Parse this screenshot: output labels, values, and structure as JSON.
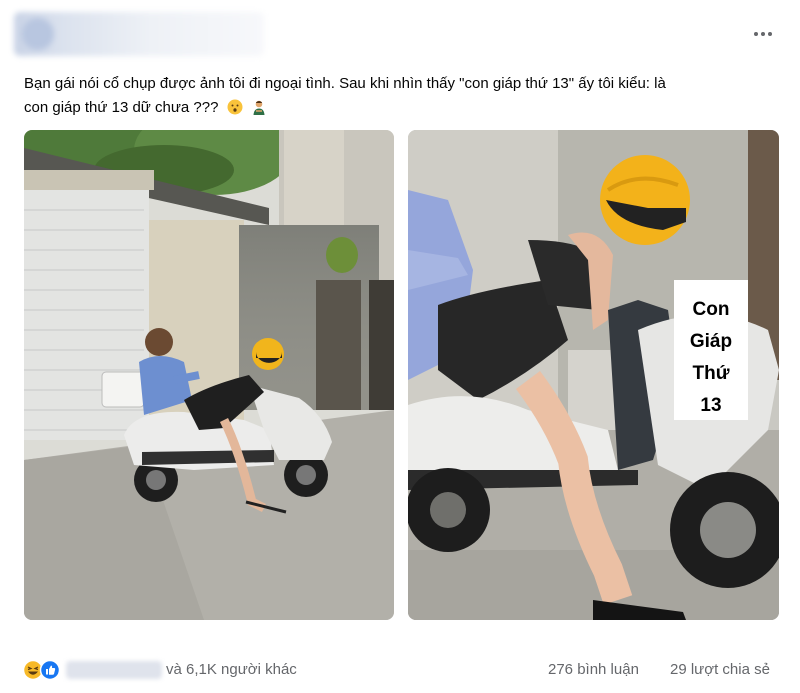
{
  "post": {
    "caption_line1": "Bạn gái nói cổ chụp được ảnh tôi đi ngoại tình. Sau khi nhìn thấy \"con giáp thứ 13\" ấy tôi kiểu: là",
    "caption_line2": "con giáp thứ 13 dữ chưa ???",
    "caption_emojis": [
      "hushed-face-emoji",
      "man-gesturing-emoji"
    ],
    "menu_icon": "more-horizontal-icon"
  },
  "photos": {
    "overlay_label": [
      "Con",
      "Giáp",
      "Thứ",
      "13"
    ]
  },
  "footer": {
    "reaction_icons": [
      "haha-reaction-icon",
      "like-reaction-icon"
    ],
    "others_text": "và 6,1K người khác",
    "comments": "276 bình luận",
    "shares": "29 lượt chia sẻ"
  },
  "colors": {
    "like_blue": "#1877f2",
    "haha_yellow": "#f7b928",
    "secondary_text": "#65676b"
  }
}
